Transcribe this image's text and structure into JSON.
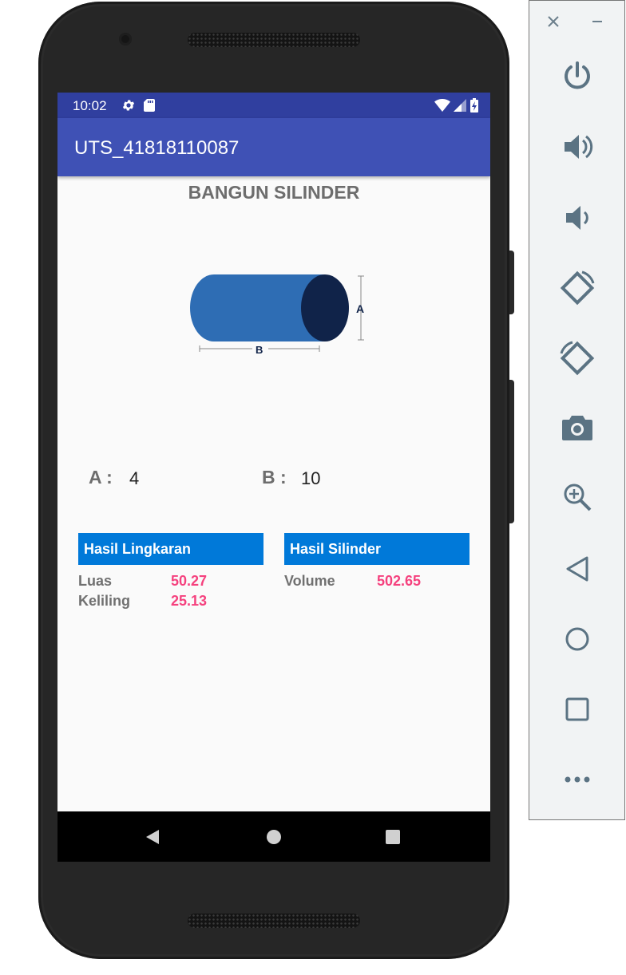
{
  "status_bar": {
    "time": "10:02"
  },
  "app_bar": {
    "title": "UTS_41818110087"
  },
  "heading": "BANGUN SILINDER",
  "diagram": {
    "label_a": "A",
    "label_b": "B"
  },
  "inputs": {
    "a": {
      "label": "A :",
      "value": "4"
    },
    "b": {
      "label": "B :",
      "value": "10"
    }
  },
  "results": {
    "circle": {
      "header": "Hasil Lingkaran",
      "rows": [
        {
          "label": "Luas",
          "value": "50.27"
        },
        {
          "label": "Keliling",
          "value": "25.13"
        }
      ]
    },
    "cylinder": {
      "header": "Hasil Silinder",
      "rows": [
        {
          "label": "Volume",
          "value": "502.65"
        }
      ]
    }
  },
  "colors": {
    "status_bar": "#303f9f",
    "app_bar": "#3f51b5",
    "header_box": "#0079d9",
    "accent": "#f5417e",
    "cylinder_body": "#2e6db4",
    "cylinder_end": "#102349"
  },
  "emulator_panel": {
    "icons": [
      "close-icon",
      "minimize-icon",
      "power-icon",
      "volume-up-icon",
      "volume-down-icon",
      "rotate-left-icon",
      "rotate-right-icon",
      "camera-icon",
      "zoom-icon",
      "back-icon",
      "home-icon",
      "overview-icon",
      "more-icon"
    ]
  }
}
